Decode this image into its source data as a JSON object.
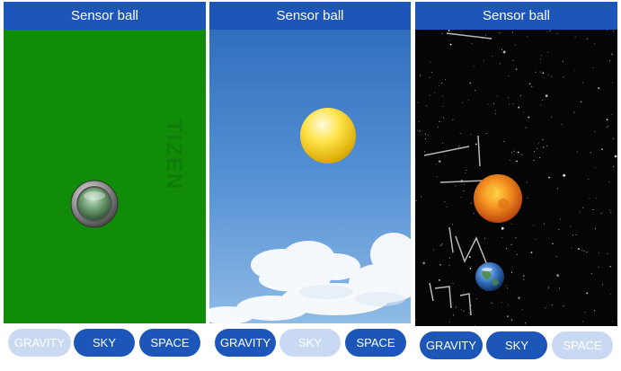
{
  "app": {
    "title": "Sensor ball"
  },
  "panels": [
    {
      "title": "Sensor ball",
      "scene": "gravity",
      "ball": "metal-button",
      "watermark": "TIZEN",
      "tabs": [
        {
          "label": "GRAVITY",
          "active": false
        },
        {
          "label": "SKY",
          "active": true
        },
        {
          "label": "SPACE",
          "active": true
        }
      ]
    },
    {
      "title": "Sensor ball",
      "scene": "sky",
      "ball": "yellow-ball",
      "tabs": [
        {
          "label": "GRAVITY",
          "active": true
        },
        {
          "label": "SKY",
          "active": false
        },
        {
          "label": "SPACE",
          "active": true
        }
      ]
    },
    {
      "title": "Sensor ball",
      "scene": "space",
      "ball": "sun-ball",
      "tabs": [
        {
          "label": "GRAVITY",
          "active": true
        },
        {
          "label": "SKY",
          "active": true
        },
        {
          "label": "SPACE",
          "active": false
        }
      ]
    }
  ],
  "colors": {
    "title_bar": "#1b56b8",
    "tab_active": "#1b56b8",
    "tab_inactive": "#c8d9f1",
    "gravity_bg": "#108c08"
  }
}
